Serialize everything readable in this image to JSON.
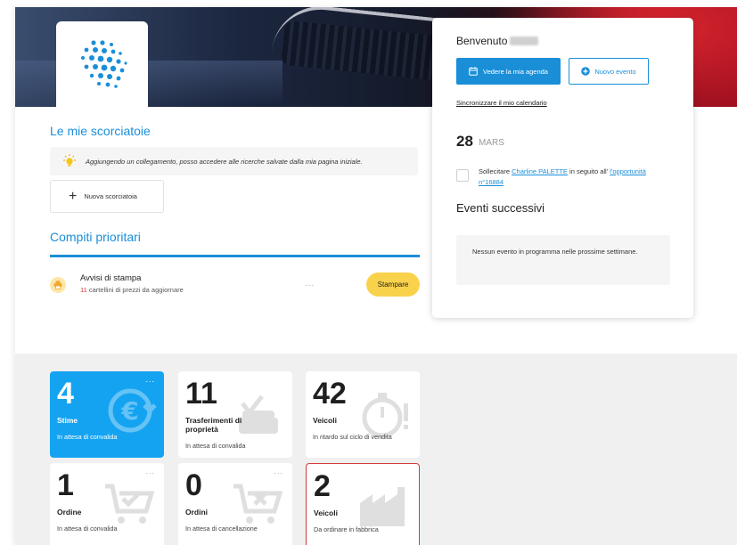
{
  "brand": {
    "accent": "#1a8fd8",
    "tile_blue": "#14a3f0",
    "print_yellow": "#f9d24b",
    "alert_red": "#d83a3a"
  },
  "shortcuts": {
    "title": "Le mie scorciatoie",
    "tip": "Aggiungendo un collegamento, posso accedere alle ricerche salvate dalla mia pagina iniziale.",
    "new_label": "Nuova scorciatoia"
  },
  "tasks": {
    "title": "Compiti prioritari",
    "items": [
      {
        "title": "Avvisi di stampa",
        "count": "11",
        "subtitle": "cartellini di prezzi da aggiornare",
        "more": "...",
        "action": "Stampare"
      }
    ]
  },
  "agenda": {
    "welcome": "Benvenuto",
    "agenda_button": "Vedere la mia agenda",
    "new_event_button": "Nuovo evento",
    "sync_link": "Sincronizzare il mio calendario",
    "date_day": "28",
    "date_month": "MARS",
    "reminder_prefix": "Sollecitare",
    "reminder_contact": "Charline PALETTE",
    "reminder_middle": "in seguito all'",
    "reminder_link": "l'opportunità n°16884",
    "next_events_title": "Eventi successivi",
    "no_events": "Nessun evento in programma nelle prossime settimane."
  },
  "tiles": [
    {
      "value": "4",
      "label": "Stime",
      "desc": "In attesa di convalida",
      "icon": "euro-refresh-icon",
      "more": "..."
    },
    {
      "value": "11",
      "label": "Trasferimenti di proprietà",
      "desc": "In attesa di convalida",
      "icon": "car-check-icon"
    },
    {
      "value": "42",
      "label": "Veicoli",
      "desc": "In ritardo sul ciclo di vendita",
      "icon": "stopwatch-icon"
    },
    {
      "value": "1",
      "label": "Ordine",
      "desc": "In attesa di convalida",
      "icon": "cart-check-icon",
      "more": "..."
    },
    {
      "value": "0",
      "label": "Ordini",
      "desc": "In attesa di cancellazione",
      "icon": "cart-cancel-icon",
      "more": "..."
    },
    {
      "value": "2",
      "label": "Veicoli",
      "desc": "Da ordinare in fabbrica",
      "icon": "factory-icon"
    }
  ]
}
